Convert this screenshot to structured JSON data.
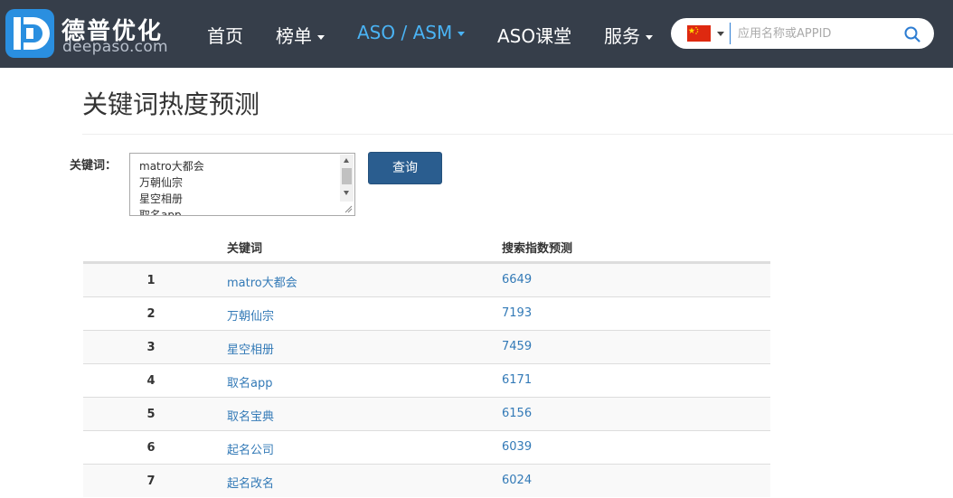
{
  "header": {
    "logo_cn": "德普优化",
    "logo_en": "deepaso.com",
    "nav": [
      {
        "label": "首页",
        "has_caret": false,
        "active": false
      },
      {
        "label": "榜单",
        "has_caret": true,
        "active": false
      },
      {
        "label": "ASO / ASM",
        "has_caret": true,
        "active": true
      },
      {
        "label": "ASO课堂",
        "has_caret": false,
        "active": false
      },
      {
        "label": "服务",
        "has_caret": true,
        "active": false
      }
    ],
    "search": {
      "country_flag_icon": "china-flag-icon",
      "placeholder": "应用名称或APPID",
      "value": ""
    }
  },
  "page": {
    "title": "关键词热度预测",
    "keyword_label": "关键词：",
    "keyword_lines": [
      "matro大都会",
      "万朝仙宗",
      "星空相册",
      "取名app"
    ],
    "query_button": "查询"
  },
  "table": {
    "headers": {
      "keyword": "关键词",
      "prediction": "搜索指数预测"
    },
    "rows": [
      {
        "index": "1",
        "keyword": "matro大都会",
        "value": "6649"
      },
      {
        "index": "2",
        "keyword": "万朝仙宗",
        "value": "7193"
      },
      {
        "index": "3",
        "keyword": "星空相册",
        "value": "7459"
      },
      {
        "index": "4",
        "keyword": "取名app",
        "value": "6171"
      },
      {
        "index": "5",
        "keyword": "取名宝典",
        "value": "6156"
      },
      {
        "index": "6",
        "keyword": "起名公司",
        "value": "6039"
      },
      {
        "index": "7",
        "keyword": "起名改名",
        "value": "6024"
      }
    ]
  },
  "colors": {
    "header_bg": "#363e4a",
    "nav_active": "#4ab3f4",
    "link": "#337ab7",
    "button": "#2a5d8f"
  }
}
